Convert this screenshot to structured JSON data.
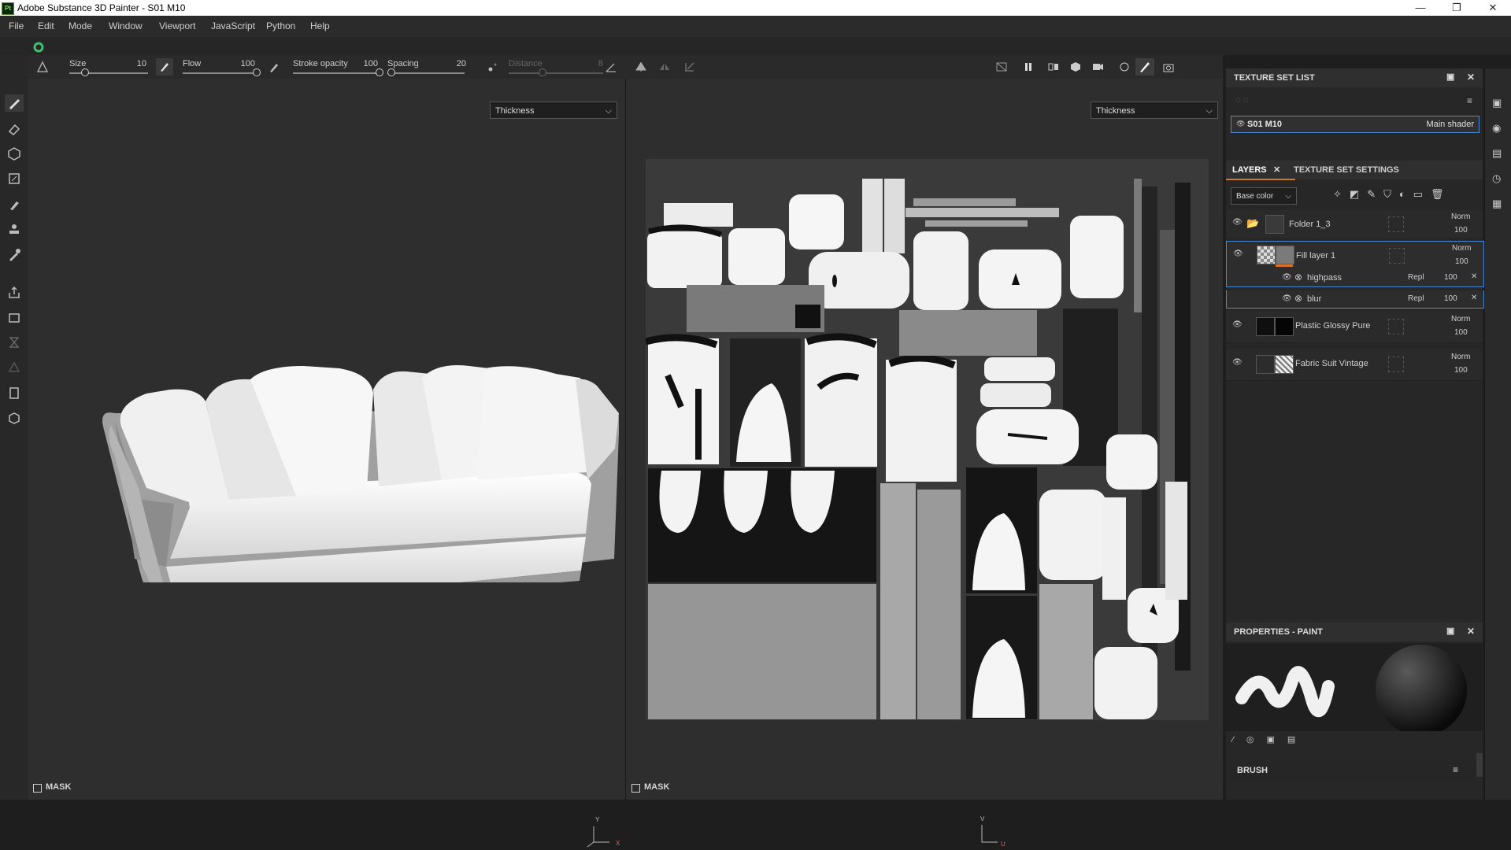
{
  "window": {
    "app_icon_text": "Pt",
    "title": "Adobe Substance 3D Painter - S01 M10",
    "minimize": "—",
    "maximize": "❐",
    "close": "✕"
  },
  "menu": [
    "File",
    "Edit",
    "Mode",
    "Window",
    "Viewport",
    "JavaScript",
    "Python",
    "Help"
  ],
  "tool_options": {
    "size_label": "Size",
    "size_value": "10",
    "size_fraction": 0.2,
    "flow_label": "Flow",
    "flow_value": "100",
    "flow_fraction": 1.0,
    "stroke_opacity_label": "Stroke opacity",
    "stroke_opacity_value": "100",
    "stroke_opacity_fraction": 1.0,
    "spacing_label": "Spacing",
    "spacing_value": "20",
    "spacing_fraction": 0.05,
    "distance_label": "Distance",
    "distance_value": "8"
  },
  "viewport3d": {
    "channel_dropdown": "Thickness",
    "mask_label": "MASK",
    "axis_y": "Y",
    "axis_x": "X"
  },
  "viewport2d": {
    "channel_dropdown": "Thickness",
    "mask_label": "MASK",
    "axis_v": "V",
    "axis_u": "U"
  },
  "texture_set_list": {
    "title": "TEXTURE SET LIST",
    "set_name": "S01 M10",
    "shader": "Main shader"
  },
  "layers_panel": {
    "tab_layers": "LAYERS",
    "tab_settings": "TEXTURE SET SETTINGS",
    "channel_select": "Base color",
    "layers": [
      {
        "name": "Folder 1_3",
        "blend": "Norm",
        "opacity": "100"
      },
      {
        "name": "Fill layer 1",
        "blend": "Norm",
        "opacity": "100"
      },
      {
        "name": "Plastic Glossy Pure",
        "blend": "Norm",
        "opacity": "100"
      },
      {
        "name": "Fabric Suit Vintage",
        "blend": "Norm",
        "opacity": "100"
      }
    ],
    "effects": [
      {
        "name": "highpass",
        "blend": "Repl",
        "opacity": "100"
      },
      {
        "name": "blur",
        "blend": "Repl",
        "opacity": "100"
      }
    ]
  },
  "properties": {
    "title": "PROPERTIES - PAINT",
    "brush_label": "BRUSH"
  }
}
